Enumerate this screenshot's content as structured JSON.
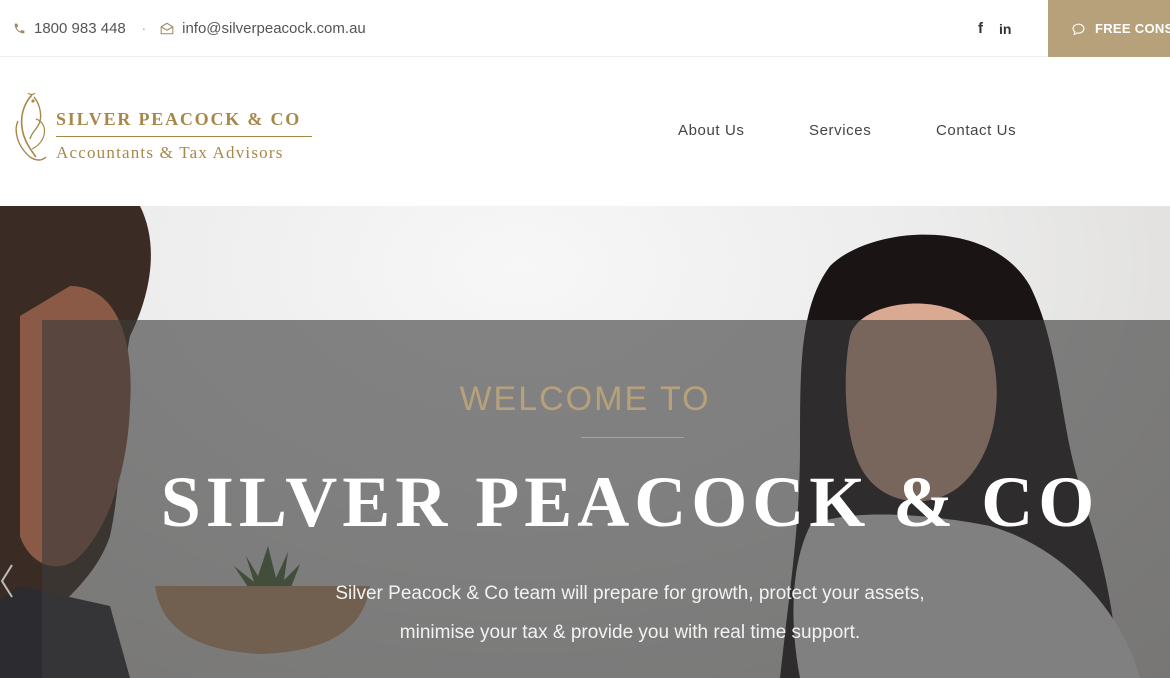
{
  "topbar": {
    "phone": "1800 983 448",
    "separator": "·",
    "email": "info@silverpeacock.com.au",
    "social": {
      "facebook": "f",
      "linkedin": "in"
    },
    "cta_label": "FREE CONS",
    "icons": {
      "phone": "phone-icon",
      "email": "envelope-icon",
      "cta": "chat-bubble-icon"
    }
  },
  "logo": {
    "name": "SILVER PEACOCK & CO",
    "tagline": "Accountants & Tax Advisors"
  },
  "nav": {
    "items": [
      {
        "label": "About Us"
      },
      {
        "label": "Services"
      },
      {
        "label": "Contact Us"
      }
    ]
  },
  "hero": {
    "welcome": "WELCOME TO",
    "headline": "SILVER PEACOCK & CO",
    "subtitle_line1": "Silver Peacock & Co team will prepare for growth, protect your assets,",
    "subtitle_line2": "minimise your tax & provide you with real time support."
  },
  "colors": {
    "accent_gold": "#b7a17b",
    "logo_gold": "#a8884a",
    "overlay": "#3c3c3c"
  }
}
